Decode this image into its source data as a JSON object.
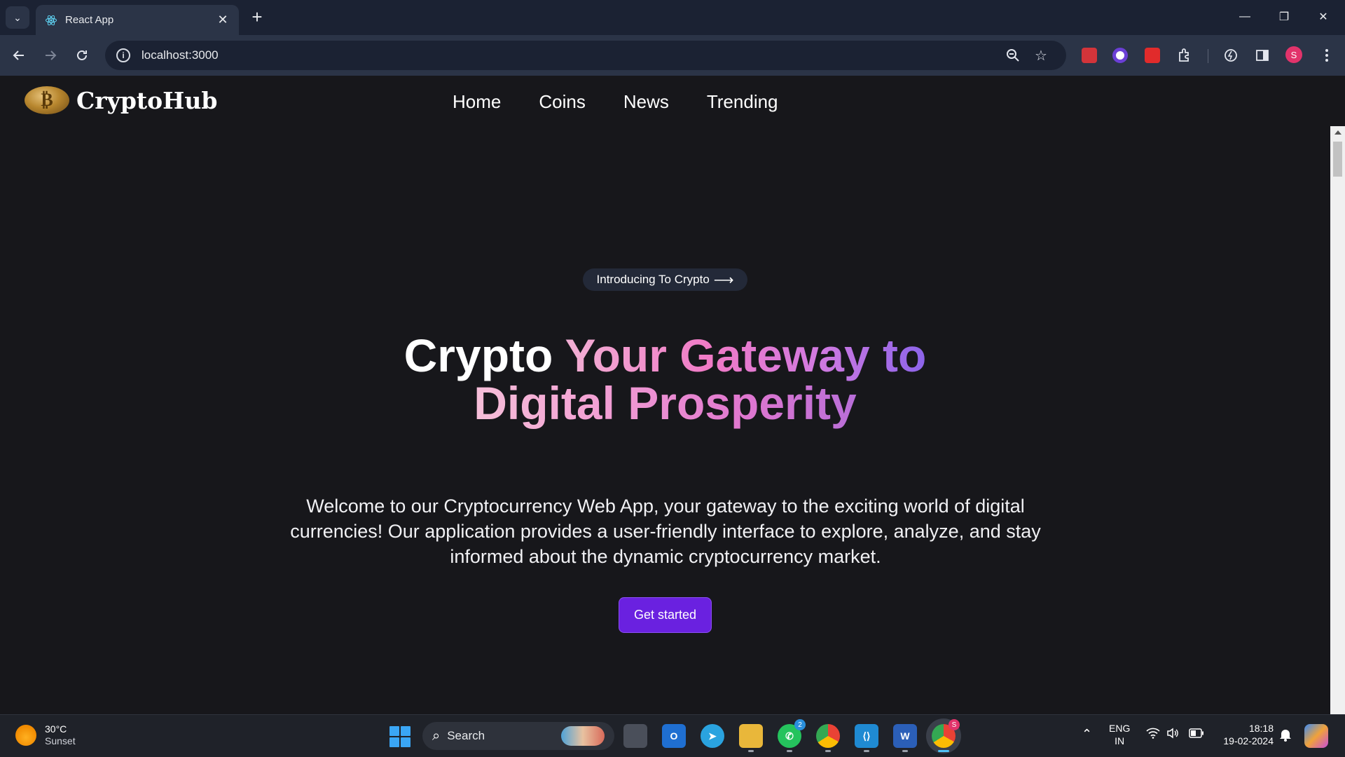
{
  "browser": {
    "tab_title": "React App",
    "url": "localhost:3000"
  },
  "site": {
    "brand": "CryptoHub",
    "nav": [
      "Home",
      "Coins",
      "News",
      "Trending"
    ]
  },
  "hero": {
    "pill_label": "Introducing To Crypto",
    "headline_plain": "Crypto",
    "headline_grad1": "Your Gateway to",
    "headline_grad2": "Digital Prosperity",
    "intro": "Welcome to our Cryptocurrency Web App, your gateway to the exciting world of digital currencies! Our application provides a user-friendly interface to explore, analyze, and stay informed about the dynamic cryptocurrency market.",
    "cta": "Get started"
  },
  "taskbar": {
    "weather_temp": "30°C",
    "weather_desc": "Sunset",
    "search_label": "Search",
    "whatsapp_badge": "2",
    "chrome_badge": "S",
    "lang": "ENG",
    "region": "IN",
    "time": "18:18",
    "date": "19-02-2024"
  },
  "profile_initial": "S",
  "colors": {
    "accent": "#6a21e0",
    "page_bg": "#17171b",
    "chrome_bg": "#1b2233"
  }
}
